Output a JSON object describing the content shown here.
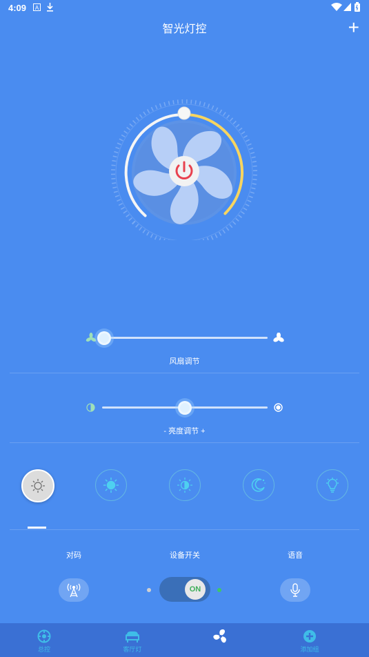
{
  "status": {
    "time": "4:09"
  },
  "header": {
    "title": "智光灯控",
    "add_label": "+"
  },
  "fan": {
    "power_icon": "power-icon",
    "speed_value": 0.0,
    "speed_label": "风扇调节",
    "brightness_value": 0.5,
    "brightness_label": "- 亮度调节 +"
  },
  "modes": [
    {
      "icon": "sun-outline-icon",
      "active": true
    },
    {
      "icon": "sun-full-icon",
      "active": false
    },
    {
      "icon": "sun-half-icon",
      "active": false
    },
    {
      "icon": "moon-icon",
      "active": false
    },
    {
      "icon": "bulb-icon",
      "active": false
    }
  ],
  "controls": {
    "pair_label": "对码",
    "switch_label": "设备开关",
    "voice_label": "语音",
    "toggle_text": "ON",
    "toggle_on": true
  },
  "nav": {
    "items": [
      {
        "label": "总控",
        "icon": "master-control-icon"
      },
      {
        "label": "客厅灯",
        "icon": "sofa-icon"
      },
      {
        "label": "",
        "icon": "fan-icon"
      },
      {
        "label": "添加组",
        "icon": "add-group-icon"
      }
    ]
  },
  "colors": {
    "background": "#4a8cf0",
    "arc": "#f7d560",
    "power": "#e8414e",
    "accent": "#3fbde8",
    "nav": "#3a70d4"
  }
}
